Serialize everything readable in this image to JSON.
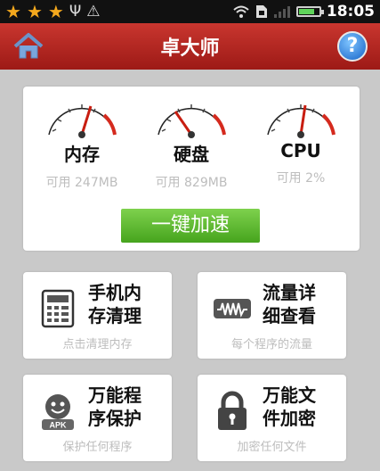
{
  "status_bar": {
    "time": "18:05",
    "icons": [
      "star-icon",
      "star-icon",
      "star-icon",
      "usb-icon",
      "warning-icon",
      "wifi-icon",
      "sim-card-icon",
      "signal-icon",
      "battery-icon"
    ]
  },
  "header": {
    "title": "卓大师",
    "home_icon": "home-icon",
    "help_icon": "help-icon",
    "help_glyph": "?"
  },
  "stats": {
    "memory": {
      "label": "内存",
      "sub": "可用 247MB"
    },
    "disk": {
      "label": "硬盘",
      "sub": "可用 829MB"
    },
    "cpu": {
      "label": "CPU",
      "sub": "可用 2%"
    },
    "boost_label": "一键加速"
  },
  "tiles": [
    {
      "title": "手机内存清理",
      "title_l1": "手机内",
      "title_l2": "存清理",
      "sub": "点击清理内存",
      "icon": "calculator-icon"
    },
    {
      "title": "流量详细查看",
      "title_l1": "流量详",
      "title_l2": "细查看",
      "sub": "每个程序的流量",
      "icon": "traffic-wave-icon"
    },
    {
      "title": "万能程序保护",
      "title_l1": "万能程",
      "title_l2": "序保护",
      "sub": "保护任何程序",
      "icon": "apk-robot-icon",
      "icon_text": "APK"
    },
    {
      "title": "万能文件加密",
      "title_l1": "万能文",
      "title_l2": "件加密",
      "sub": "加密任何文件",
      "icon": "padlock-icon"
    }
  ],
  "colors": {
    "header": "#b42823",
    "boost": "#5bb82e",
    "background": "#c9c9c9",
    "star": "#f4a81d"
  }
}
